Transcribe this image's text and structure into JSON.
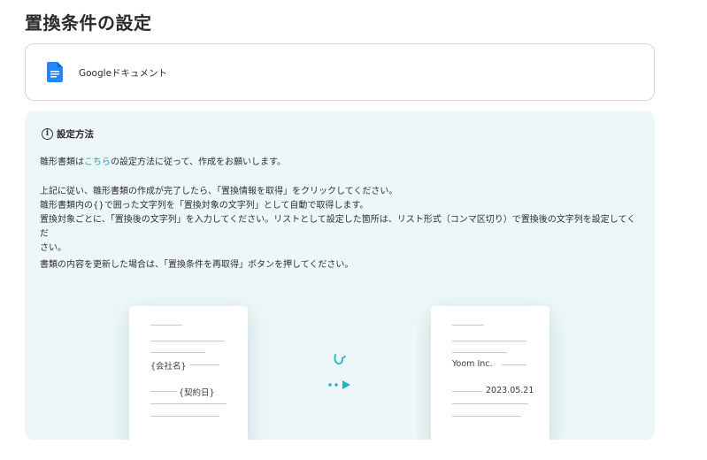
{
  "page": {
    "title": "置換条件の設定"
  },
  "app": {
    "name": "Googleドキュメント",
    "icon": "google-docs-icon",
    "icon_color": "#2684fc"
  },
  "info": {
    "title": "設定方法",
    "p1_pre": "雛形書類は",
    "p1_link": "こちら",
    "p1_post": "の設定方法に従って、作成をお願いします。",
    "p2_l1": "上記に従い、雛形書類の作成が完了したら、「置換情報を取得」をクリックしてください。",
    "p2_l2": "雛形書類内の{}で囲った文字列を「置換対象の文字列」として自動で取得します。",
    "p2_l3": "置換対象ごとに、「置換後の文字列」を入力してください。リストとして設定した箇所は、リスト形式（コンマ区切り）で置換後の文字列を設定してくだ",
    "p2_l4": "さい。",
    "p3": "書類の内容を更新した場合は、「置換条件を再取得」ボタンを押してください。"
  },
  "illustration": {
    "left": {
      "company": "{会社名}",
      "date": "{契約日}"
    },
    "right": {
      "company": "Yoom Inc.",
      "date": "2023.05.21"
    },
    "accent_color": "#1fb5c9"
  }
}
